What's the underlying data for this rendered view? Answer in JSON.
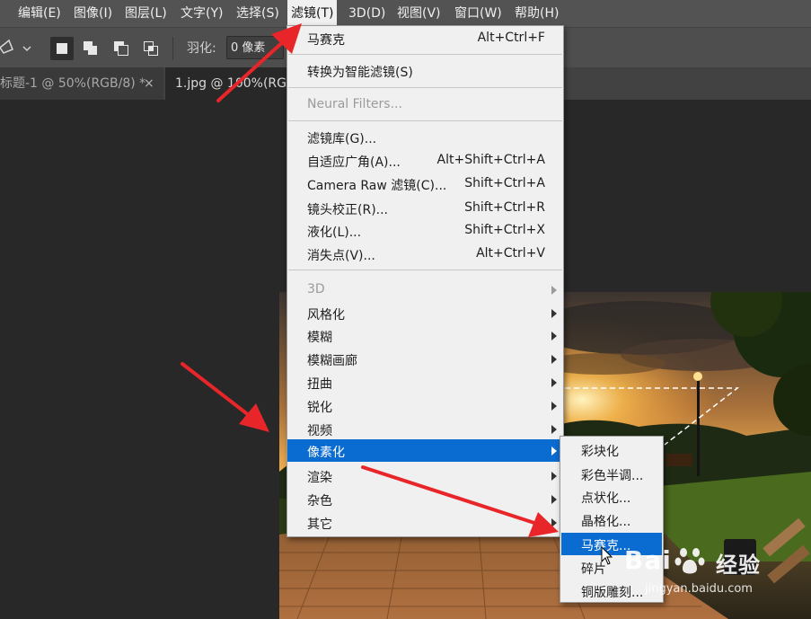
{
  "menubar": {
    "items": [
      {
        "label": "编辑(E)"
      },
      {
        "label": "图像(I)"
      },
      {
        "label": "图层(L)"
      },
      {
        "label": "文字(Y)"
      },
      {
        "label": "选择(S)"
      },
      {
        "label": "滤镜(T)",
        "active": true
      },
      {
        "label": "3D(D)"
      },
      {
        "label": "视图(V)"
      },
      {
        "label": "窗口(W)"
      },
      {
        "label": "帮助(H)"
      }
    ]
  },
  "options_bar": {
    "feather_label": "羽化:",
    "feather_value": "0 像素"
  },
  "tabs": [
    {
      "label": "标题-1 @ 50%(RGB/8) *",
      "close": "×"
    },
    {
      "label": "1.jpg @ 100%(RGB"
    }
  ],
  "filter_menu": {
    "items": [
      {
        "label": "马赛克",
        "shortcut": "Alt+Ctrl+F"
      },
      {
        "label": "转换为智能滤镜(S)",
        "shortcut": ""
      },
      {
        "label": "Neural Filters...",
        "shortcut": "",
        "disabled": true
      },
      {
        "label": "滤镜库(G)...",
        "shortcut": ""
      },
      {
        "label": "自适应广角(A)...",
        "shortcut": "Alt+Shift+Ctrl+A"
      },
      {
        "label": "Camera Raw 滤镜(C)...",
        "shortcut": "Shift+Ctrl+A"
      },
      {
        "label": "镜头校正(R)...",
        "shortcut": "Shift+Ctrl+R"
      },
      {
        "label": "液化(L)...",
        "shortcut": "Shift+Ctrl+X"
      },
      {
        "label": "消失点(V)...",
        "shortcut": "Alt+Ctrl+V"
      },
      {
        "label": "3D",
        "disabled": true,
        "submenu": true
      },
      {
        "label": "风格化",
        "submenu": true
      },
      {
        "label": "模糊",
        "submenu": true
      },
      {
        "label": "模糊画廊",
        "submenu": true
      },
      {
        "label": "扭曲",
        "submenu": true
      },
      {
        "label": "锐化",
        "submenu": true
      },
      {
        "label": "视频",
        "submenu": true
      },
      {
        "label": "像素化",
        "submenu": true,
        "highlighted": true
      },
      {
        "label": "渲染",
        "submenu": true
      },
      {
        "label": "杂色",
        "submenu": true
      },
      {
        "label": "其它",
        "submenu": true
      }
    ]
  },
  "pixelate_submenu": {
    "items": [
      {
        "label": "彩块化"
      },
      {
        "label": "彩色半调..."
      },
      {
        "label": "点状化..."
      },
      {
        "label": "晶格化..."
      },
      {
        "label": "马赛克...",
        "highlighted": true
      },
      {
        "label": "碎片"
      },
      {
        "label": "铜版雕刻..."
      }
    ]
  },
  "watermark": {
    "brand": "Bai",
    "brand_cn": "经验",
    "url": "jingyan.baidu.com"
  },
  "colors": {
    "menubar": "#535353",
    "menu_bg": "#f0f0f0",
    "highlight": "#0a6bd0",
    "annotation_arrow": "#e8262a"
  }
}
